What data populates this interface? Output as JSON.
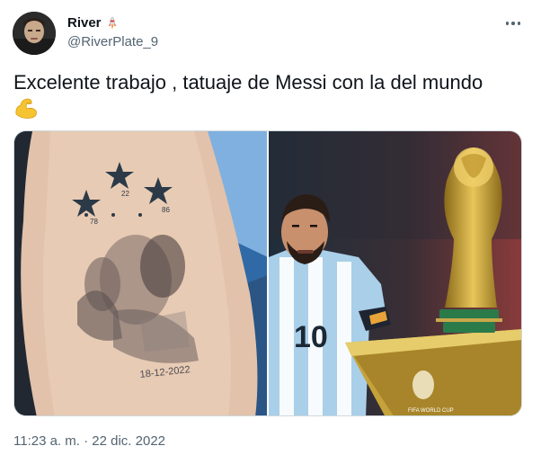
{
  "user": {
    "display_name": "River",
    "handle": "@RiverPlate_9",
    "badge_icon": "rocket-icon"
  },
  "tweet": {
    "text": "Excelente trabajo , tatuaje de Messi con la del mundo",
    "emoji_icon": "flexed-biceps-icon"
  },
  "media": {
    "left_image": {
      "tattoo_date": "18-12-2022",
      "star_numbers": [
        "78",
        "22",
        "86"
      ]
    },
    "right_image": {
      "jersey_number": "10",
      "trophy_base_text": "FIFA WORLD CUP"
    }
  },
  "meta": {
    "time": "11:23 a. m.",
    "separator": "·",
    "date": "22 dic. 2022"
  },
  "colors": {
    "text_primary": "#0f1419",
    "text_secondary": "#536471",
    "border": "#cfd9de"
  }
}
